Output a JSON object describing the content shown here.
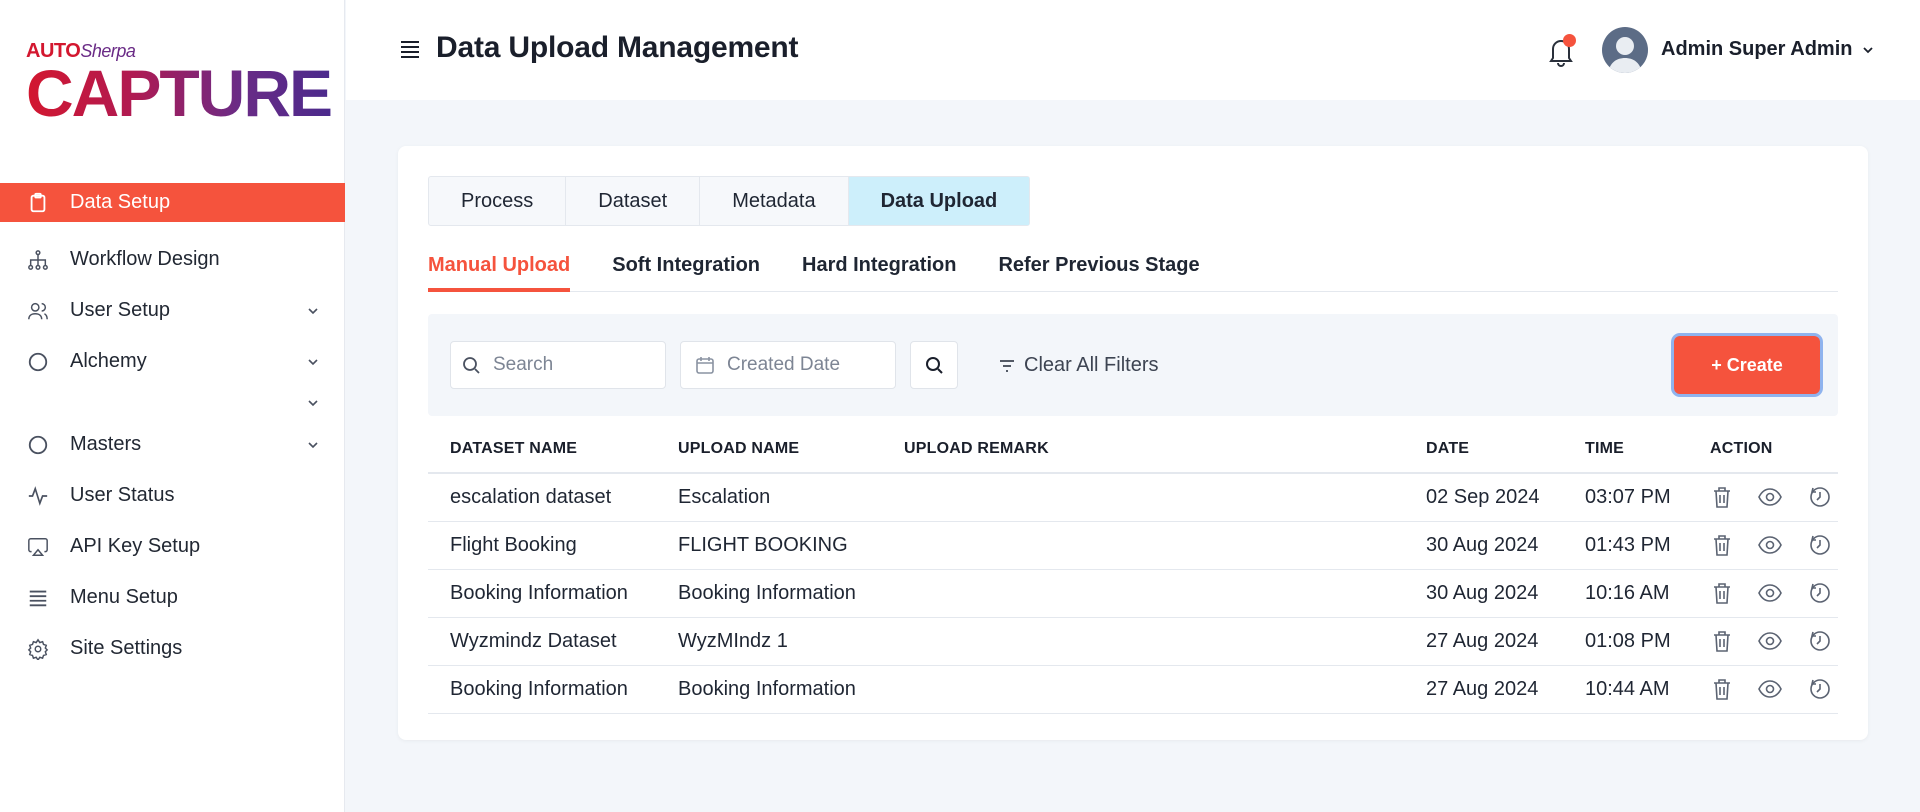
{
  "brand": {
    "top_auto": "AUTO",
    "top_sherpa": "Sherpa",
    "main": "CAPTURE"
  },
  "sidebar": {
    "items": [
      {
        "label": "Data Setup",
        "icon": "clipboard-icon",
        "active": true
      },
      {
        "label": "Workflow Design",
        "icon": "hierarchy-icon"
      },
      {
        "label": "User Setup",
        "icon": "users-icon",
        "has_chevron": true
      },
      {
        "label": "Alchemy",
        "icon": "circle-icon",
        "has_chevron": true
      },
      {
        "label": "Masters",
        "icon": "circle-icon",
        "has_chevron": true
      },
      {
        "label": "User Status",
        "icon": "activity-icon"
      },
      {
        "label": "API Key Setup",
        "icon": "airplay-icon"
      },
      {
        "label": "Menu Setup",
        "icon": "list-icon"
      },
      {
        "label": "Site Settings",
        "icon": "gear-icon"
      }
    ]
  },
  "header": {
    "title": "Data Upload Management",
    "user_name": "Admin Super Admin"
  },
  "tabs": [
    "Process",
    "Dataset",
    "Metadata",
    "Data Upload"
  ],
  "active_tab": "Data Upload",
  "subtabs": [
    "Manual Upload",
    "Soft Integration",
    "Hard Integration",
    "Refer Previous Stage"
  ],
  "active_subtab": "Manual Upload",
  "filters": {
    "search_placeholder": "Search",
    "date_placeholder": "Created Date",
    "clear_label": "Clear All Filters",
    "create_label": "+ Create"
  },
  "table": {
    "headers": [
      "DATASET NAME",
      "UPLOAD NAME",
      "UPLOAD REMARK",
      "DATE",
      "TIME",
      "ACTION"
    ],
    "rows": [
      {
        "dataset": "escalation dataset",
        "upload": "Escalation",
        "remark": "",
        "date": "02 Sep 2024",
        "time": "03:07 PM"
      },
      {
        "dataset": "Flight Booking",
        "upload": "FLIGHT BOOKING",
        "remark": "",
        "date": "30 Aug 2024",
        "time": "01:43 PM"
      },
      {
        "dataset": "Booking Information",
        "upload": "Booking Information",
        "remark": "",
        "date": "30 Aug 2024",
        "time": "10:16 AM"
      },
      {
        "dataset": "Wyzmindz Dataset",
        "upload": "WyzMIndz 1",
        "remark": "",
        "date": "27 Aug 2024",
        "time": "01:08 PM"
      },
      {
        "dataset": "Booking Information",
        "upload": "Booking Information",
        "remark": "",
        "date": "27 Aug 2024",
        "time": "10:44 AM"
      }
    ]
  },
  "colors": {
    "accent": "#f5533d",
    "active_tab_bg": "#cdeffb",
    "page_bg": "#f3f6fa"
  }
}
